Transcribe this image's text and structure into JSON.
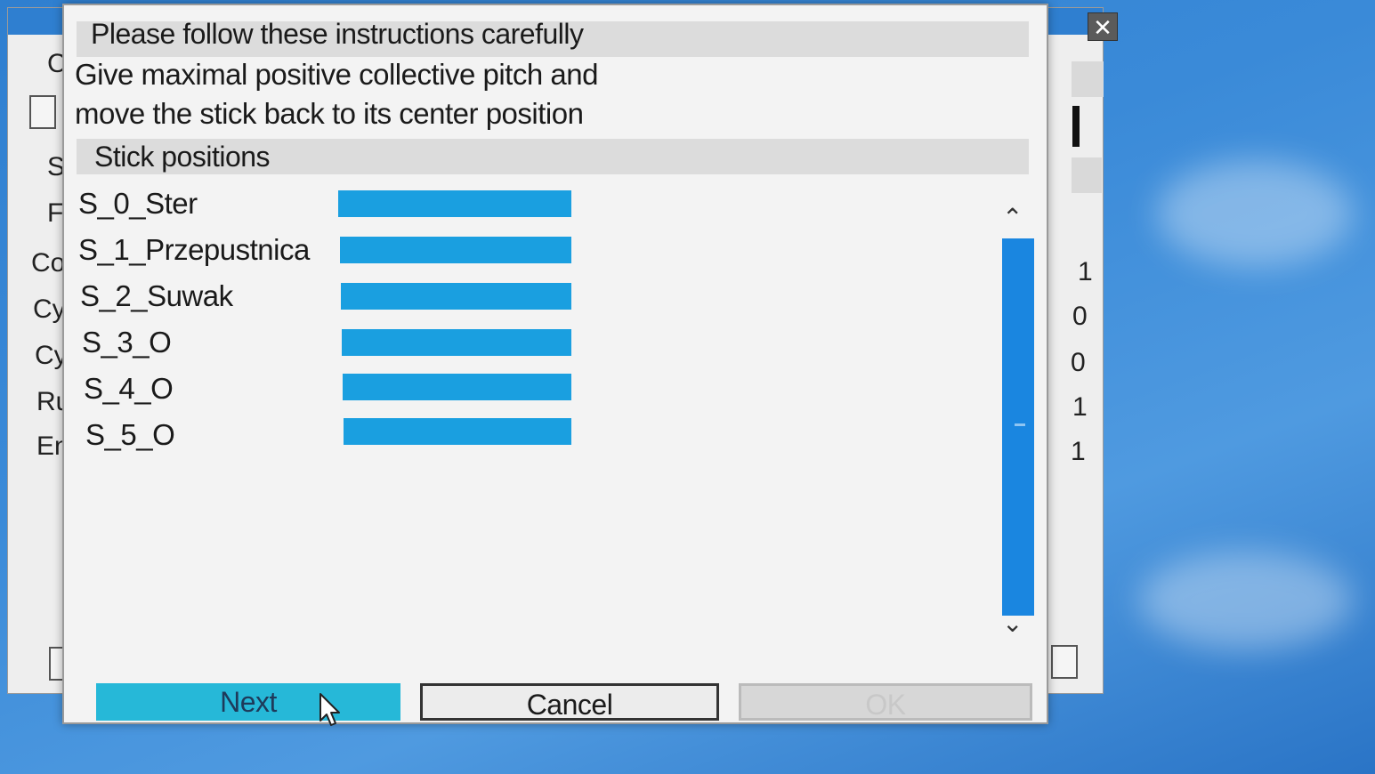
{
  "dialog": {
    "header": "Please follow these instructions carefully",
    "instruction_line1": "Give maximal positive collective pitch and",
    "instruction_line2": "move the stick back to its center position",
    "stick_section_title": "Stick positions",
    "sticks": [
      {
        "label": "S_0_Ster"
      },
      {
        "label": "S_1_Przepustnica"
      },
      {
        "label": "S_2_Suwak"
      },
      {
        "label": "S_3_O"
      },
      {
        "label": "S_4_O"
      },
      {
        "label": "S_5_O"
      }
    ],
    "buttons": {
      "next": "Next",
      "cancel": "Cancel",
      "ok": "OK"
    }
  },
  "background_window": {
    "fragments": [
      "C",
      "S",
      "F",
      "Co",
      "Cy",
      "Cy",
      "Ru",
      "En"
    ],
    "values": [
      "1",
      "0",
      "0",
      "1",
      "1"
    ],
    "close_glyph": "✕"
  },
  "colors": {
    "bar": "#1a9fe0",
    "next_button": "#26b8d8",
    "scroll_thumb": "#1a86e0",
    "desktop": "#2f7fd0"
  }
}
